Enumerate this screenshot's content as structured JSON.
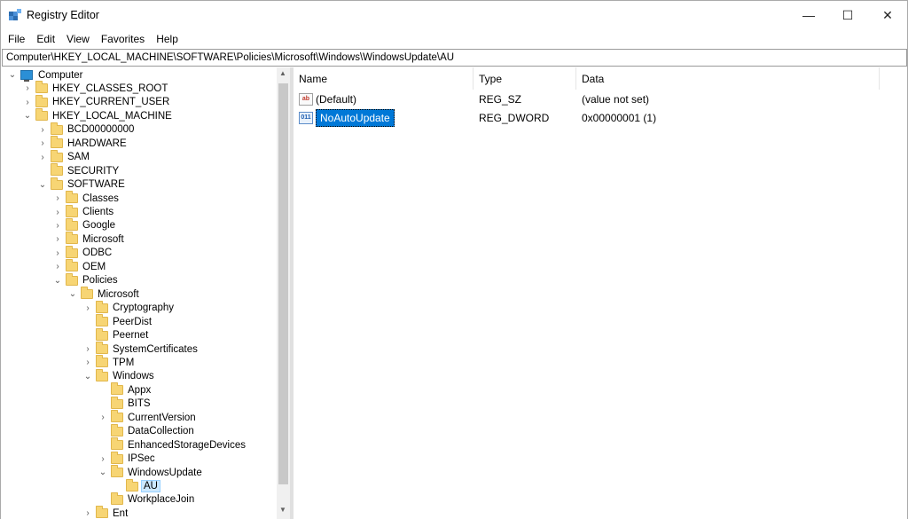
{
  "window": {
    "title": "Registry Editor",
    "controls": {
      "minimize": "—",
      "maximize": "☐",
      "close": "✕"
    }
  },
  "menu": [
    "File",
    "Edit",
    "View",
    "Favorites",
    "Help"
  ],
  "address": "Computer\\HKEY_LOCAL_MACHINE\\SOFTWARE\\Policies\\Microsoft\\Windows\\WindowsUpdate\\AU",
  "tree": [
    {
      "label": "Computer",
      "level": 0,
      "twisty": "open",
      "icon": "computer-icon"
    },
    {
      "label": "HKEY_CLASSES_ROOT",
      "level": 1,
      "twisty": "closed",
      "icon": "folder-icon"
    },
    {
      "label": "HKEY_CURRENT_USER",
      "level": 1,
      "twisty": "closed",
      "icon": "folder-icon"
    },
    {
      "label": "HKEY_LOCAL_MACHINE",
      "level": 1,
      "twisty": "open",
      "icon": "folder-icon"
    },
    {
      "label": "BCD00000000",
      "level": 2,
      "twisty": "closed",
      "icon": "folder-icon"
    },
    {
      "label": "HARDWARE",
      "level": 2,
      "twisty": "closed",
      "icon": "folder-icon"
    },
    {
      "label": "SAM",
      "level": 2,
      "twisty": "closed",
      "icon": "folder-icon"
    },
    {
      "label": "SECURITY",
      "level": 2,
      "twisty": "none",
      "icon": "folder-icon"
    },
    {
      "label": "SOFTWARE",
      "level": 2,
      "twisty": "open",
      "icon": "folder-icon"
    },
    {
      "label": "Classes",
      "level": 3,
      "twisty": "closed",
      "icon": "folder-icon"
    },
    {
      "label": "Clients",
      "level": 3,
      "twisty": "closed",
      "icon": "folder-icon"
    },
    {
      "label": "Google",
      "level": 3,
      "twisty": "closed",
      "icon": "folder-icon"
    },
    {
      "label": "Microsoft",
      "level": 3,
      "twisty": "closed",
      "icon": "folder-icon"
    },
    {
      "label": "ODBC",
      "level": 3,
      "twisty": "closed",
      "icon": "folder-icon"
    },
    {
      "label": "OEM",
      "level": 3,
      "twisty": "closed",
      "icon": "folder-icon"
    },
    {
      "label": "Policies",
      "level": 3,
      "twisty": "open",
      "icon": "folder-icon"
    },
    {
      "label": "Microsoft",
      "level": 4,
      "twisty": "open",
      "icon": "folder-icon"
    },
    {
      "label": "Cryptography",
      "level": 5,
      "twisty": "closed",
      "icon": "folder-icon"
    },
    {
      "label": "PeerDist",
      "level": 5,
      "twisty": "none",
      "icon": "folder-icon"
    },
    {
      "label": "Peernet",
      "level": 5,
      "twisty": "none",
      "icon": "folder-icon"
    },
    {
      "label": "SystemCertificates",
      "level": 5,
      "twisty": "closed",
      "icon": "folder-icon"
    },
    {
      "label": "TPM",
      "level": 5,
      "twisty": "closed",
      "icon": "folder-icon"
    },
    {
      "label": "Windows",
      "level": 5,
      "twisty": "open",
      "icon": "folder-icon"
    },
    {
      "label": "Appx",
      "level": 6,
      "twisty": "none",
      "icon": "folder-icon"
    },
    {
      "label": "BITS",
      "level": 6,
      "twisty": "none",
      "icon": "folder-icon"
    },
    {
      "label": "CurrentVersion",
      "level": 6,
      "twisty": "closed",
      "icon": "folder-icon"
    },
    {
      "label": "DataCollection",
      "level": 6,
      "twisty": "none",
      "icon": "folder-icon"
    },
    {
      "label": "EnhancedStorageDevices",
      "level": 6,
      "twisty": "none",
      "icon": "folder-icon"
    },
    {
      "label": "IPSec",
      "level": 6,
      "twisty": "closed",
      "icon": "folder-icon"
    },
    {
      "label": "WindowsUpdate",
      "level": 6,
      "twisty": "open",
      "icon": "folder-icon"
    },
    {
      "label": "AU",
      "level": 7,
      "twisty": "none",
      "icon": "folder-icon",
      "selected": true
    },
    {
      "label": "WorkplaceJoin",
      "level": 6,
      "twisty": "none",
      "icon": "folder-icon"
    },
    {
      "label": "Ent",
      "level": 5,
      "twisty": "closed",
      "icon": "folder-icon"
    }
  ],
  "list": {
    "columns": [
      "Name",
      "Type",
      "Data"
    ],
    "rows": [
      {
        "name": "(Default)",
        "type": "REG_SZ",
        "data": "(value not set)",
        "icon": "string-value-icon",
        "icon_text": "ab",
        "selected": false
      },
      {
        "name": "NoAutoUpdate",
        "type": "REG_DWORD",
        "data": "0x00000001 (1)",
        "icon": "dword-value-icon",
        "icon_text": "011",
        "selected": true
      }
    ]
  }
}
